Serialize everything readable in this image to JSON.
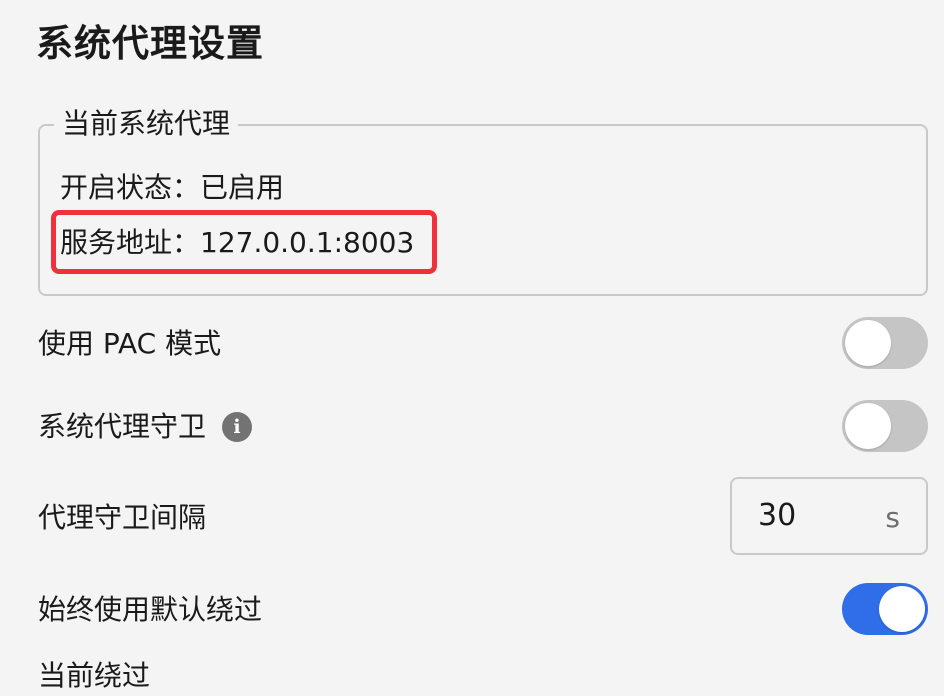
{
  "page": {
    "title": "系统代理设置"
  },
  "current_proxy": {
    "legend": "当前系统代理",
    "status_line": "开启状态：已启用",
    "address_line": "服务地址：127.0.0.1:8003"
  },
  "settings": {
    "pac_mode": {
      "label": "使用 PAC 模式",
      "enabled": false
    },
    "proxy_guard": {
      "label": "系统代理守卫",
      "enabled": false,
      "info_icon": "info-icon"
    },
    "guard_interval": {
      "label": "代理守卫间隔",
      "value": "30",
      "unit": "s"
    },
    "default_bypass": {
      "label": "始终使用默认绕过",
      "enabled": true
    },
    "next_label": "当前绕过"
  },
  "colors": {
    "accent": "#2f6ee8",
    "highlight_border": "#f0303a",
    "toggle_off": "#c5c5c5",
    "background": "#f4f4f4"
  }
}
